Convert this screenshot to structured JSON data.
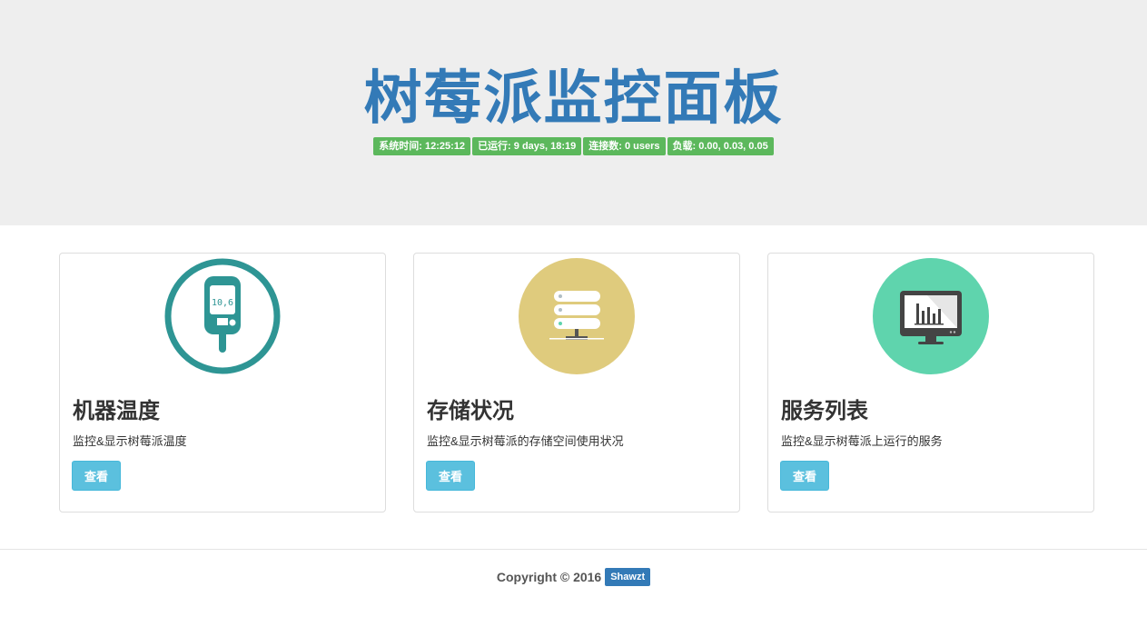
{
  "header": {
    "title": "树莓派监控面板",
    "stats": [
      {
        "label": "系统时间: 12:25:12"
      },
      {
        "label": "已运行: 9 days, 18:19"
      },
      {
        "label": "连接数: 0 users"
      },
      {
        "label": "负载: 0.00, 0.03, 0.05"
      }
    ],
    "stats_color": "#5cb85c"
  },
  "cards": [
    {
      "icon": "glucose-meter-icon",
      "icon_display": "10,6",
      "icon_color": "#2e9594",
      "title": "机器温度",
      "description": "监控&显示树莓派温度",
      "button_label": "查看"
    },
    {
      "icon": "server-storage-icon",
      "icon_color": "#dfcb7d",
      "title": "存储状况",
      "description": "监控&显示树莓派的存储空间使用状况",
      "button_label": "查看"
    },
    {
      "icon": "monitor-chart-icon",
      "icon_color": "#5fd4ad",
      "title": "服务列表",
      "description": "监控&显示树莓派上运行的服务",
      "button_label": "查看"
    }
  ],
  "footer": {
    "copyright": "Copyright © 2016",
    "author": "Shawzt"
  },
  "colors": {
    "title": "#337ab7",
    "button": "#5bc0de",
    "jumbotron_bg": "#eeeeee"
  }
}
